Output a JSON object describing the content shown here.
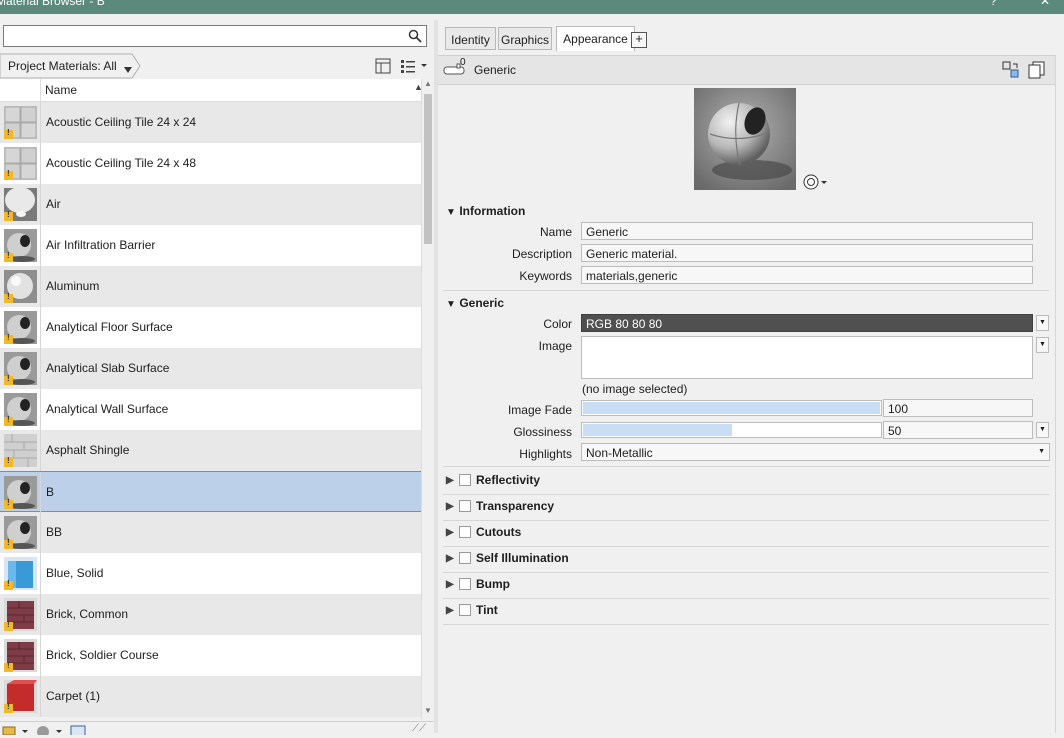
{
  "window": {
    "title": "Material Browser - B",
    "controls": [
      "?",
      "✕"
    ]
  },
  "search": {
    "value": "",
    "placeholder": ""
  },
  "filter": {
    "label": "Project Materials: All"
  },
  "list_header": {
    "name_column": "Name"
  },
  "materials": [
    {
      "name": "Acoustic Ceiling Tile 24 x 24",
      "thumb": "grid-tile",
      "warn": true
    },
    {
      "name": "Acoustic Ceiling Tile 24 x 48",
      "thumb": "grid-tile",
      "warn": true
    },
    {
      "name": "Air",
      "thumb": "air",
      "warn": true
    },
    {
      "name": "Air Infiltration Barrier",
      "thumb": "sphere-gray",
      "warn": true
    },
    {
      "name": "Aluminum",
      "thumb": "sphere-silver",
      "warn": true
    },
    {
      "name": "Analytical Floor Surface",
      "thumb": "sphere-gray",
      "warn": true
    },
    {
      "name": "Analytical Slab Surface",
      "thumb": "sphere-gray",
      "warn": true
    },
    {
      "name": "Analytical Wall Surface",
      "thumb": "sphere-gray",
      "warn": true
    },
    {
      "name": "Asphalt Shingle",
      "thumb": "shingle",
      "warn": true
    },
    {
      "name": "B",
      "thumb": "sphere-gray",
      "warn": true,
      "selected": true
    },
    {
      "name": "BB",
      "thumb": "sphere-gray",
      "warn": true
    },
    {
      "name": "Blue, Solid",
      "thumb": "blue",
      "warn": true
    },
    {
      "name": "Brick, Common",
      "thumb": "brick",
      "warn": true
    },
    {
      "name": "Brick, Soldier Course",
      "thumb": "brick",
      "warn": true
    },
    {
      "name": "Carpet (1)",
      "thumb": "carpet",
      "warn": true
    }
  ],
  "tabs": [
    {
      "label": "Identity",
      "active": false
    },
    {
      "label": "Graphics",
      "active": false
    },
    {
      "label": "Appearance",
      "active": true
    }
  ],
  "tab_add": "+",
  "asset": {
    "count": "0",
    "name": "Generic"
  },
  "information": {
    "title": "Information",
    "name_label": "Name",
    "name_value": "Generic",
    "description_label": "Description",
    "description_value": "Generic material.",
    "keywords_label": "Keywords",
    "keywords_value": "materials,generic"
  },
  "generic": {
    "title": "Generic",
    "color_label": "Color",
    "color_value": "RGB 80 80 80",
    "color_hex": "#505050",
    "image_label": "Image",
    "image_note": "(no image selected)",
    "image_fade_label": "Image Fade",
    "image_fade_value": "100",
    "image_fade_fraction": 1.0,
    "glossiness_label": "Glossiness",
    "glossiness_value": "50",
    "glossiness_fraction": 0.5,
    "highlights_label": "Highlights",
    "highlights_value": "Non-Metallic"
  },
  "sections": [
    {
      "label": "Reflectivity"
    },
    {
      "label": "Transparency"
    },
    {
      "label": "Cutouts"
    },
    {
      "label": "Self Illumination"
    },
    {
      "label": "Bump"
    },
    {
      "label": "Tint"
    }
  ]
}
